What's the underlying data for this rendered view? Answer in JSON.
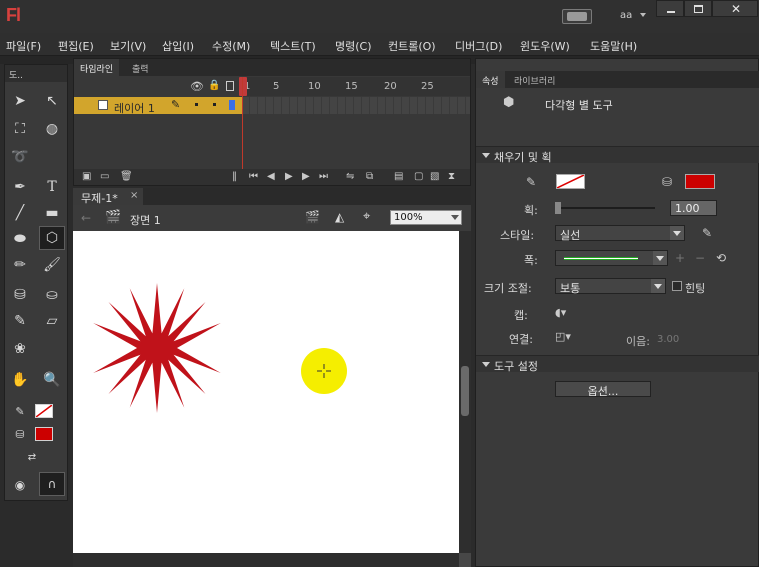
{
  "app": {
    "logo": "Fl",
    "user": "aa",
    "close_icon": "✕"
  },
  "menu": [
    "파일(F)",
    "편집(E)",
    "보기(V)",
    "삽입(I)",
    "수정(M)",
    "텍스트(T)",
    "명령(C)",
    "컨트롤(O)",
    "디버그(D)",
    "윈도우(W)",
    "도움말(H)"
  ],
  "tools_panel": {
    "title": "도.."
  },
  "timeline": {
    "tabs": [
      "타임라인",
      "출력"
    ],
    "ruler": [
      "1",
      "5",
      "10",
      "15",
      "20",
      "25"
    ],
    "layer_name": "레이어 1"
  },
  "document": {
    "tab": "무제-1*",
    "close": "×",
    "scene": "장면 1",
    "zoom": "100%"
  },
  "properties": {
    "tabs": [
      "속성",
      "라이브러리"
    ],
    "tool_name": "다각형 별 도구",
    "fill_stroke_section": "채우기 및 획",
    "stroke_label": "획:",
    "stroke_value": "1.00",
    "style_label": "스타일:",
    "style_value": "실선",
    "width_label": "폭:",
    "scale_label": "크기 조절:",
    "scale_value": "보통",
    "hinting_label": "힌팅",
    "cap_label": "캡:",
    "join_label": "연결:",
    "miter_label": "이음:",
    "miter_value": "3.00",
    "tool_settings_section": "도구 설정",
    "options_button": "옵션..."
  },
  "colors": {
    "stroke_swatch": "#ffffff",
    "fill_swatch": "#cc0000",
    "star": "#c0121a",
    "cursor_circle": "#f5ee00",
    "layer_bar": "#d2a52c"
  }
}
